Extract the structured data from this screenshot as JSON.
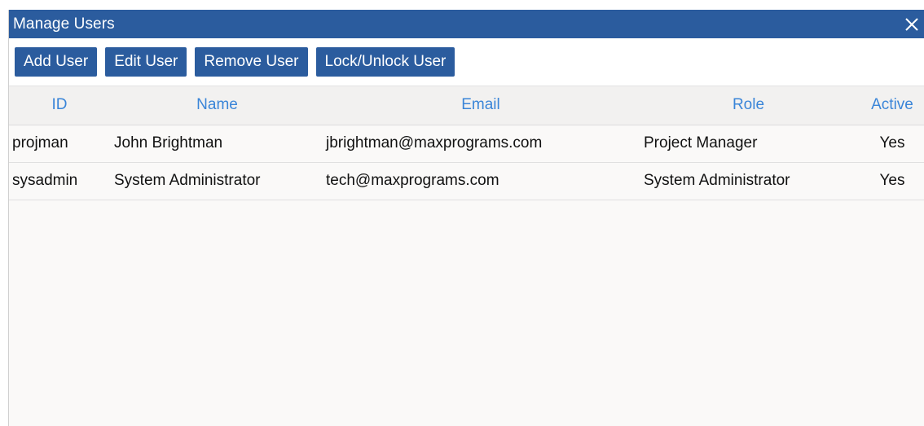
{
  "window": {
    "title": "Manage Users",
    "close_icon": "close-icon"
  },
  "toolbar": {
    "add_label": "Add User",
    "edit_label": "Edit User",
    "remove_label": "Remove User",
    "lock_label": "Lock/Unlock User"
  },
  "table": {
    "columns": [
      "ID",
      "Name",
      "Email",
      "Role",
      "Active"
    ],
    "rows": [
      {
        "id": "projman",
        "name": "John Brightman",
        "email": "jbrightman@maxprograms.com",
        "role": "Project Manager",
        "active": "Yes"
      },
      {
        "id": "sysadmin",
        "name": "System Administrator",
        "email": "tech@maxprograms.com",
        "role": "System Administrator",
        "active": "Yes"
      }
    ]
  },
  "colors": {
    "accent": "#2b5c9e",
    "header_text": "#3a85d8",
    "background": "#faf9f8"
  }
}
